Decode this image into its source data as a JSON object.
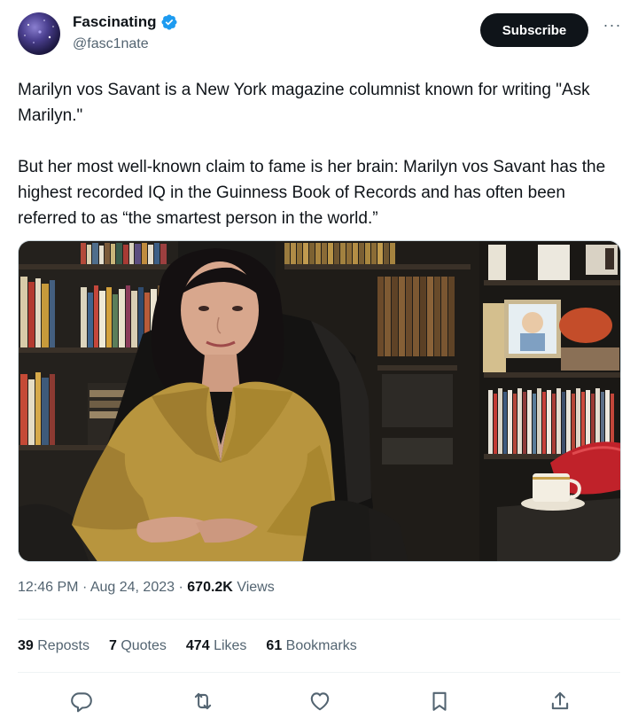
{
  "author": {
    "display_name": "Fascinating",
    "handle": "@fasc1nate",
    "verified": true
  },
  "header": {
    "subscribe_label": "Subscribe",
    "more_label": "···"
  },
  "tweet": {
    "paragraphs": [
      "Marilyn vos Savant is a New York magazine columnist known for writing \"Ask Marilyn.\"",
      "But her most well-known claim to fame is her brain: Marilyn vos Savant has the highest recorded IQ in the Guinness Book of Records and has often been referred to as “the smartest person in the world.”"
    ]
  },
  "meta": {
    "time": "12:46 PM",
    "separator": "·",
    "date": "Aug 24, 2023",
    "views_count": "670.2K",
    "views_label": "Views"
  },
  "stats": {
    "reposts_count": "39",
    "reposts_label": "Reposts",
    "quotes_count": "7",
    "quotes_label": "Quotes",
    "likes_count": "474",
    "likes_label": "Likes",
    "bookmarks_count": "61",
    "bookmarks_label": "Bookmarks"
  },
  "actions": [
    "reply-icon",
    "repost-icon",
    "like-icon",
    "bookmark-icon",
    "share-icon"
  ],
  "colors": {
    "text_primary": "#0f1419",
    "text_secondary": "#536471",
    "verified_blue": "#1d9bf0",
    "subscribe_bg": "#0f1419",
    "divider": "#eff3f4"
  }
}
